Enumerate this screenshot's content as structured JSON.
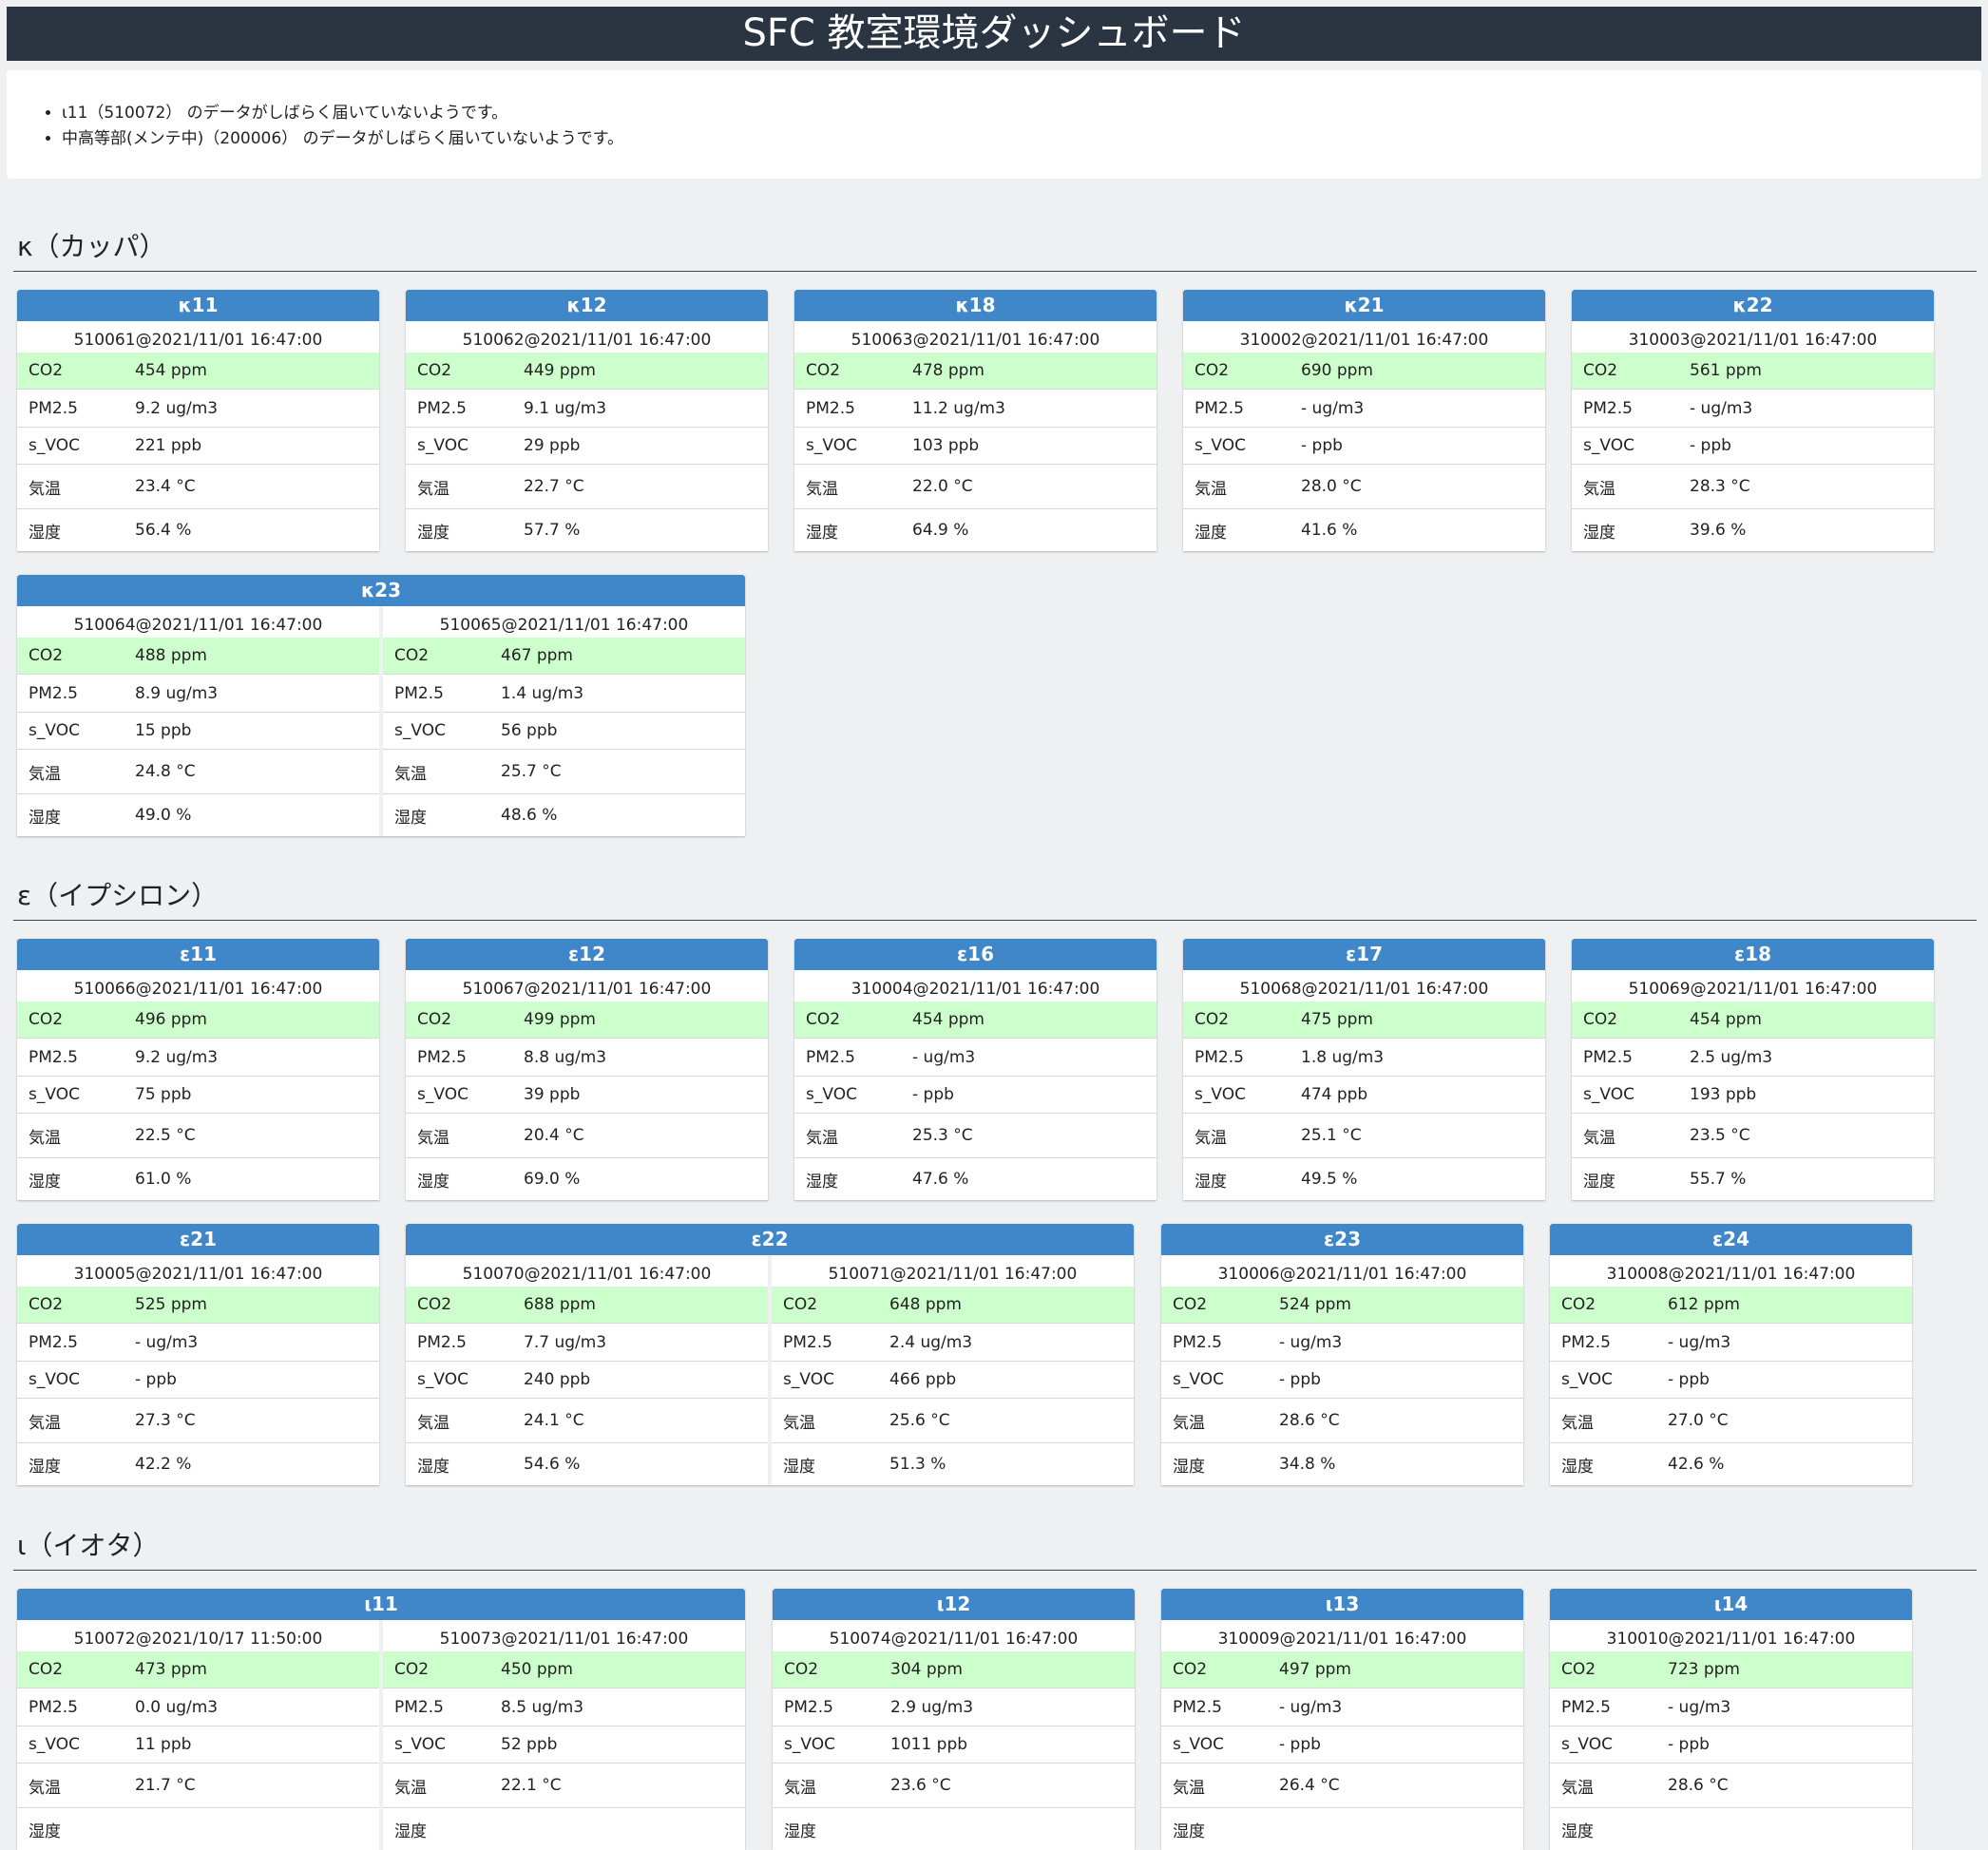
{
  "header": {
    "title": "SFC 教室環境ダッシュボード"
  },
  "alerts": [
    "ι11（510072） のデータがしばらく届いていないようです。",
    "中高等部(メンテ中)（200006） のデータがしばらく届いていないようです。"
  ],
  "sections": [
    {
      "title": "κ（カッパ）",
      "rooms": [
        {
          "name": "κ11",
          "sensors": [
            {
              "id": "510061@2021/11/01 16:47:00",
              "co2": "454 ppm",
              "pm25": "9.2 ug/m3",
              "svoc": "221 ppb",
              "temp": "23.4 °C",
              "humidity": "56.4 %"
            }
          ]
        },
        {
          "name": "κ12",
          "sensors": [
            {
              "id": "510062@2021/11/01 16:47:00",
              "co2": "449 ppm",
              "pm25": "9.1 ug/m3",
              "svoc": "29 ppb",
              "temp": "22.7 °C",
              "humidity": "57.7 %"
            }
          ]
        },
        {
          "name": "κ18",
          "sensors": [
            {
              "id": "510063@2021/11/01 16:47:00",
              "co2": "478 ppm",
              "pm25": "11.2 ug/m3",
              "svoc": "103 ppb",
              "temp": "22.0 °C",
              "humidity": "64.9 %"
            }
          ]
        },
        {
          "name": "κ21",
          "sensors": [
            {
              "id": "310002@2021/11/01 16:47:00",
              "co2": "690 ppm",
              "pm25": "- ug/m3",
              "svoc": "- ppb",
              "temp": "28.0 °C",
              "humidity": "41.6 %"
            }
          ]
        },
        {
          "name": "κ22",
          "sensors": [
            {
              "id": "310003@2021/11/01 16:47:00",
              "co2": "561 ppm",
              "pm25": "- ug/m3",
              "svoc": "- ppb",
              "temp": "28.3 °C",
              "humidity": "39.6 %"
            }
          ]
        },
        {
          "name": "κ23",
          "sensors": [
            {
              "id": "510064@2021/11/01 16:47:00",
              "co2": "488 ppm",
              "pm25": "8.9 ug/m3",
              "svoc": "15 ppb",
              "temp": "24.8 °C",
              "humidity": "49.0 %"
            },
            {
              "id": "510065@2021/11/01 16:47:00",
              "co2": "467 ppm",
              "pm25": "1.4 ug/m3",
              "svoc": "56 ppb",
              "temp": "25.7 °C",
              "humidity": "48.6 %"
            }
          ]
        }
      ]
    },
    {
      "title": "ε（イプシロン）",
      "rooms": [
        {
          "name": "ε11",
          "sensors": [
            {
              "id": "510066@2021/11/01 16:47:00",
              "co2": "496 ppm",
              "pm25": "9.2 ug/m3",
              "svoc": "75 ppb",
              "temp": "22.5 °C",
              "humidity": "61.0 %"
            }
          ]
        },
        {
          "name": "ε12",
          "sensors": [
            {
              "id": "510067@2021/11/01 16:47:00",
              "co2": "499 ppm",
              "pm25": "8.8 ug/m3",
              "svoc": "39 ppb",
              "temp": "20.4 °C",
              "humidity": "69.0 %"
            }
          ]
        },
        {
          "name": "ε16",
          "sensors": [
            {
              "id": "310004@2021/11/01 16:47:00",
              "co2": "454 ppm",
              "pm25": "- ug/m3",
              "svoc": "- ppb",
              "temp": "25.3 °C",
              "humidity": "47.6 %"
            }
          ]
        },
        {
          "name": "ε17",
          "sensors": [
            {
              "id": "510068@2021/11/01 16:47:00",
              "co2": "475 ppm",
              "pm25": "1.8 ug/m3",
              "svoc": "474 ppb",
              "temp": "25.1 °C",
              "humidity": "49.5 %"
            }
          ]
        },
        {
          "name": "ε18",
          "sensors": [
            {
              "id": "510069@2021/11/01 16:47:00",
              "co2": "454 ppm",
              "pm25": "2.5 ug/m3",
              "svoc": "193 ppb",
              "temp": "23.5 °C",
              "humidity": "55.7 %"
            }
          ]
        },
        {
          "name": "ε21",
          "sensors": [
            {
              "id": "310005@2021/11/01 16:47:00",
              "co2": "525 ppm",
              "pm25": "- ug/m3",
              "svoc": "- ppb",
              "temp": "27.3 °C",
              "humidity": "42.2 %"
            }
          ]
        },
        {
          "name": "ε22",
          "sensors": [
            {
              "id": "510070@2021/11/01 16:47:00",
              "co2": "688 ppm",
              "pm25": "7.7 ug/m3",
              "svoc": "240 ppb",
              "temp": "24.1 °C",
              "humidity": "54.6 %"
            },
            {
              "id": "510071@2021/11/01 16:47:00",
              "co2": "648 ppm",
              "pm25": "2.4 ug/m3",
              "svoc": "466 ppb",
              "temp": "25.6 °C",
              "humidity": "51.3 %"
            }
          ]
        },
        {
          "name": "ε23",
          "sensors": [
            {
              "id": "310006@2021/11/01 16:47:00",
              "co2": "524 ppm",
              "pm25": "- ug/m3",
              "svoc": "- ppb",
              "temp": "28.6 °C",
              "humidity": "34.8 %"
            }
          ]
        },
        {
          "name": "ε24",
          "sensors": [
            {
              "id": "310008@2021/11/01 16:47:00",
              "co2": "612 ppm",
              "pm25": "- ug/m3",
              "svoc": "- ppb",
              "temp": "27.0 °C",
              "humidity": "42.6 %"
            }
          ]
        }
      ]
    },
    {
      "title": "ι（イオタ）",
      "rooms": [
        {
          "name": "ι11",
          "sensors": [
            {
              "id": "510072@2021/10/17 11:50:00",
              "co2": "473 ppm",
              "pm25": "0.0 ug/m3",
              "svoc": "11 ppb",
              "temp": "21.7 °C",
              "humidity": ""
            },
            {
              "id": "510073@2021/11/01 16:47:00",
              "co2": "450 ppm",
              "pm25": "8.5 ug/m3",
              "svoc": "52 ppb",
              "temp": "22.1 °C",
              "humidity": ""
            }
          ]
        },
        {
          "name": "ι12",
          "sensors": [
            {
              "id": "510074@2021/11/01 16:47:00",
              "co2": "304 ppm",
              "pm25": "2.9 ug/m3",
              "svoc": "1011 ppb",
              "temp": "23.6 °C",
              "humidity": ""
            }
          ]
        },
        {
          "name": "ι13",
          "sensors": [
            {
              "id": "310009@2021/11/01 16:47:00",
              "co2": "497 ppm",
              "pm25": "- ug/m3",
              "svoc": "- ppb",
              "temp": "26.4 °C",
              "humidity": ""
            }
          ]
        },
        {
          "name": "ι14",
          "sensors": [
            {
              "id": "310010@2021/11/01 16:47:00",
              "co2": "723 ppm",
              "pm25": "- ug/m3",
              "svoc": "- ppb",
              "temp": "28.6 °C",
              "humidity": ""
            }
          ]
        }
      ]
    }
  ],
  "labels": {
    "co2": "CO2",
    "pm25": "PM2.5",
    "svoc": "s_VOC",
    "temp": "気温",
    "humidity": "湿度"
  },
  "colors": {
    "header_bg": "#2b3542",
    "card_head": "#3f87c8",
    "co2_ok": "#ccffcc"
  }
}
